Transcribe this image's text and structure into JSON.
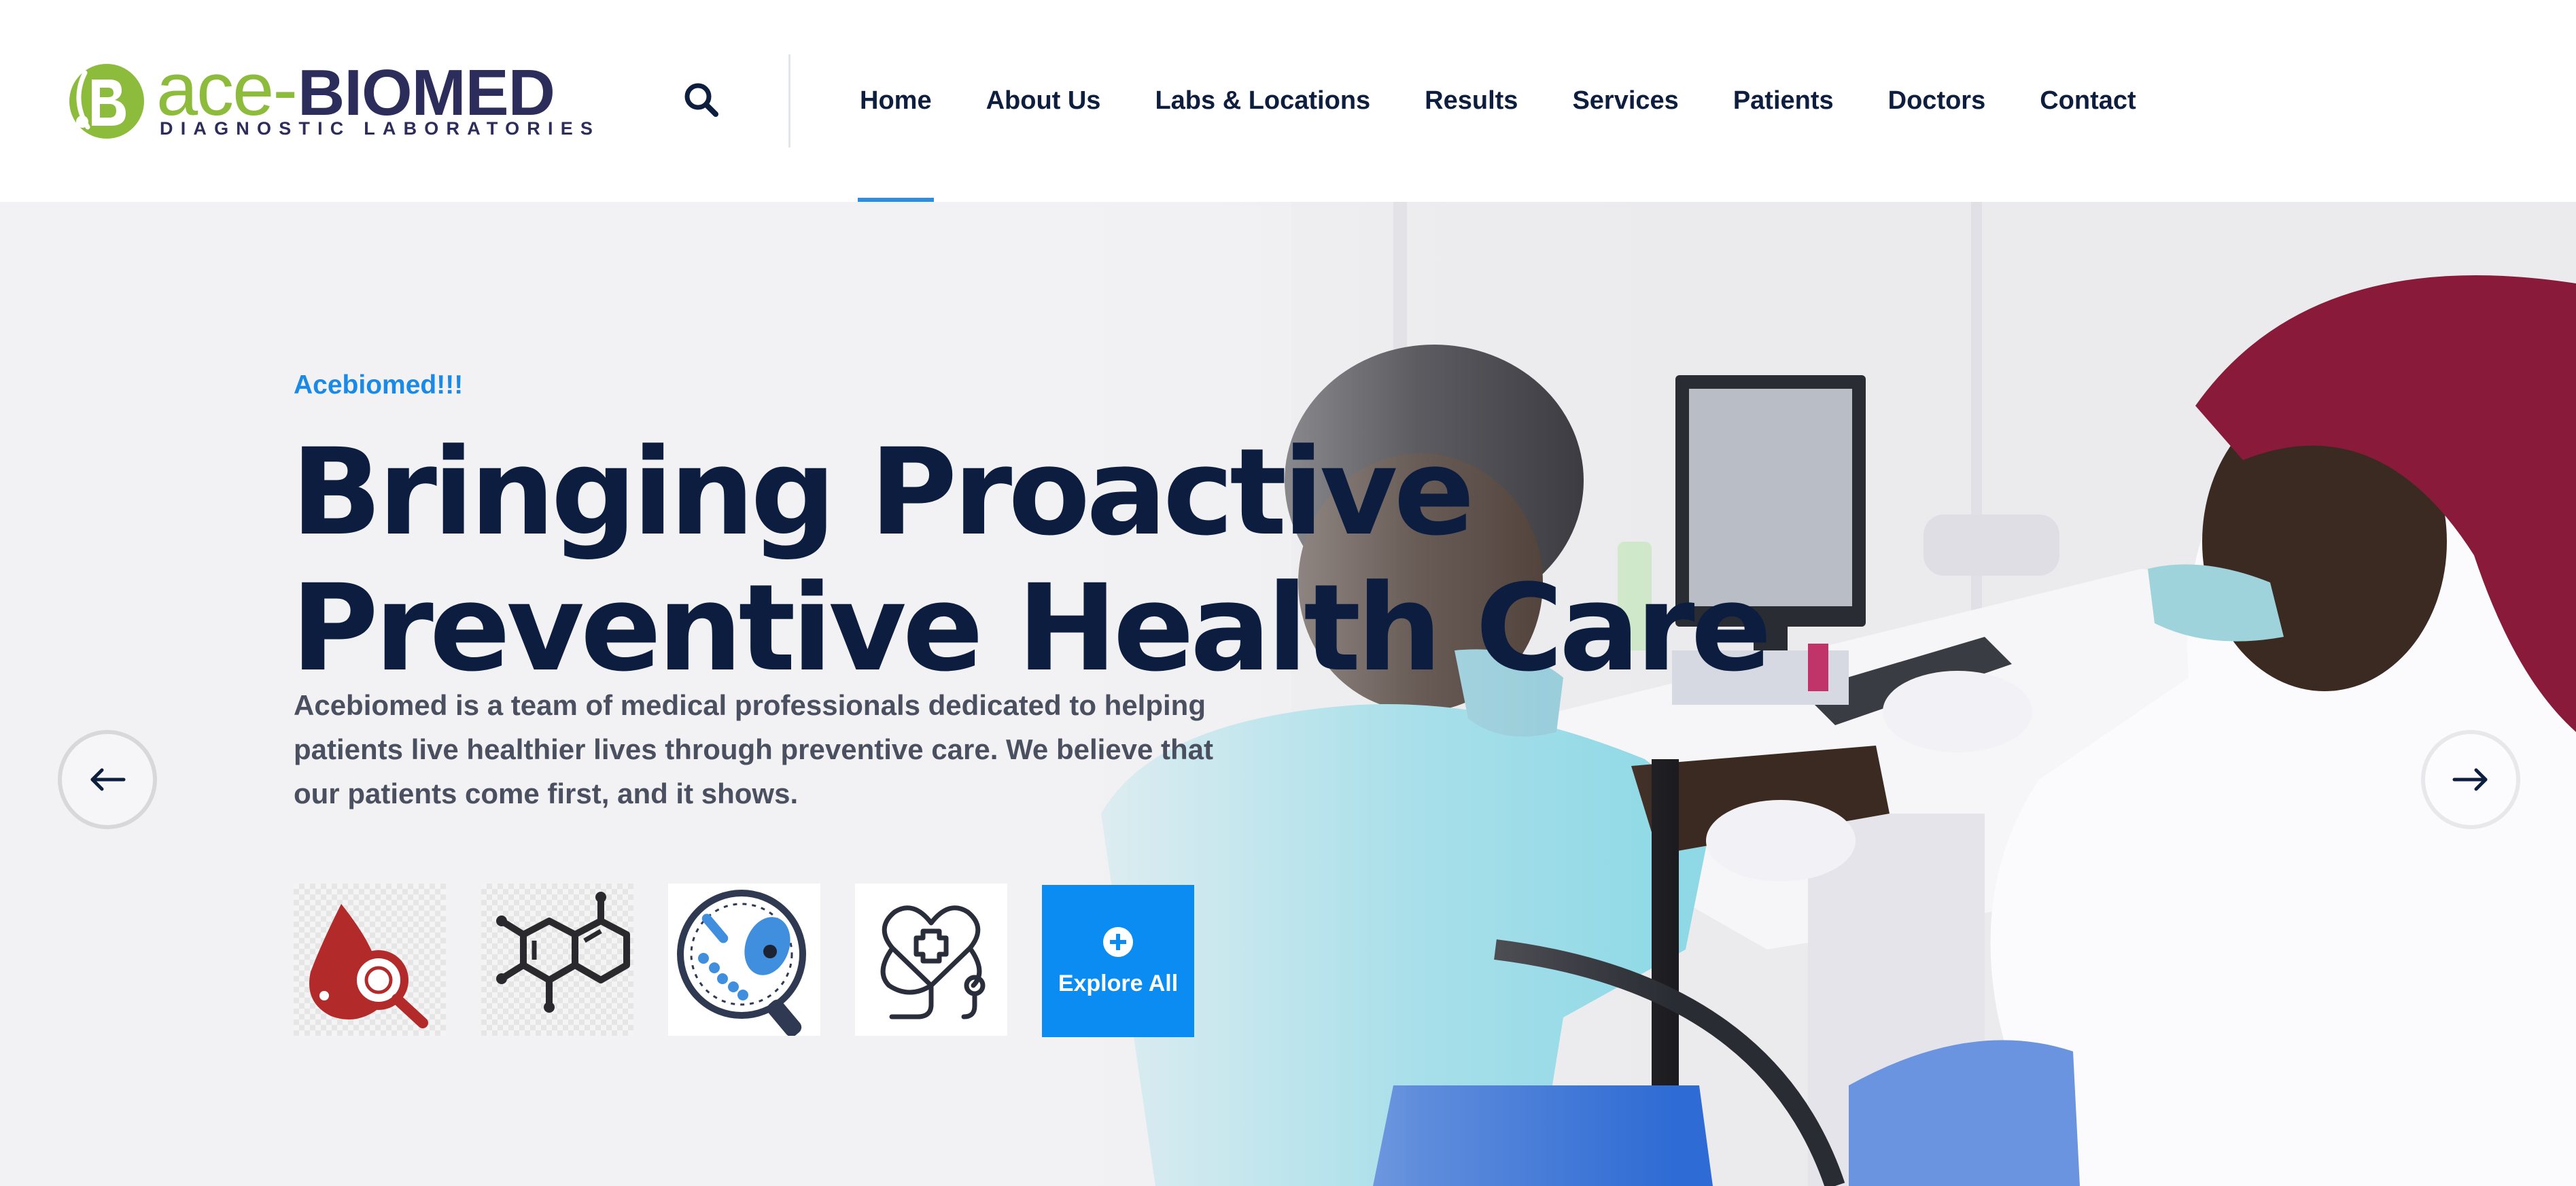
{
  "brand": {
    "name_part1": "ace",
    "name_dash": "-",
    "name_part2": "BIOMED",
    "tagline": "DIAGNOSTIC LABORATORIES",
    "colors": {
      "green": "#8dbb3c",
      "navy": "#2d2d5c"
    }
  },
  "header": {
    "search_icon": "search-icon",
    "nav": [
      {
        "label": "Home",
        "active": true
      },
      {
        "label": "About Us",
        "active": false
      },
      {
        "label": "Labs & Locations",
        "active": false
      },
      {
        "label": "Results",
        "active": false
      },
      {
        "label": "Services",
        "active": false
      },
      {
        "label": "Patients",
        "active": false
      },
      {
        "label": "Doctors",
        "active": false
      },
      {
        "label": "Contact",
        "active": false
      }
    ],
    "active_indicator_color": "#2a8fe0"
  },
  "hero": {
    "eyebrow": "Acebiomed!!!",
    "headline_line1": "Bringing Proactive",
    "headline_line2": "Preventive Health Care",
    "description": "Acebiomed is a team of medical professionals dedicated to helping patients live healthier lives through preventive care. We believe that our patients come first, and it shows.",
    "service_icons": [
      {
        "icon": "blood-test-icon"
      },
      {
        "icon": "molecule-icon"
      },
      {
        "icon": "microbiology-icon"
      },
      {
        "icon": "heart-stethoscope-icon"
      }
    ],
    "explore": {
      "label": "Explore All",
      "icon": "plus-circle-icon"
    },
    "prev_icon": "arrow-left-icon",
    "next_icon": "arrow-right-icon",
    "colors": {
      "accent": "#1a8ae6",
      "headline": "#0c1d3f",
      "button": "#0a8cf2"
    }
  }
}
